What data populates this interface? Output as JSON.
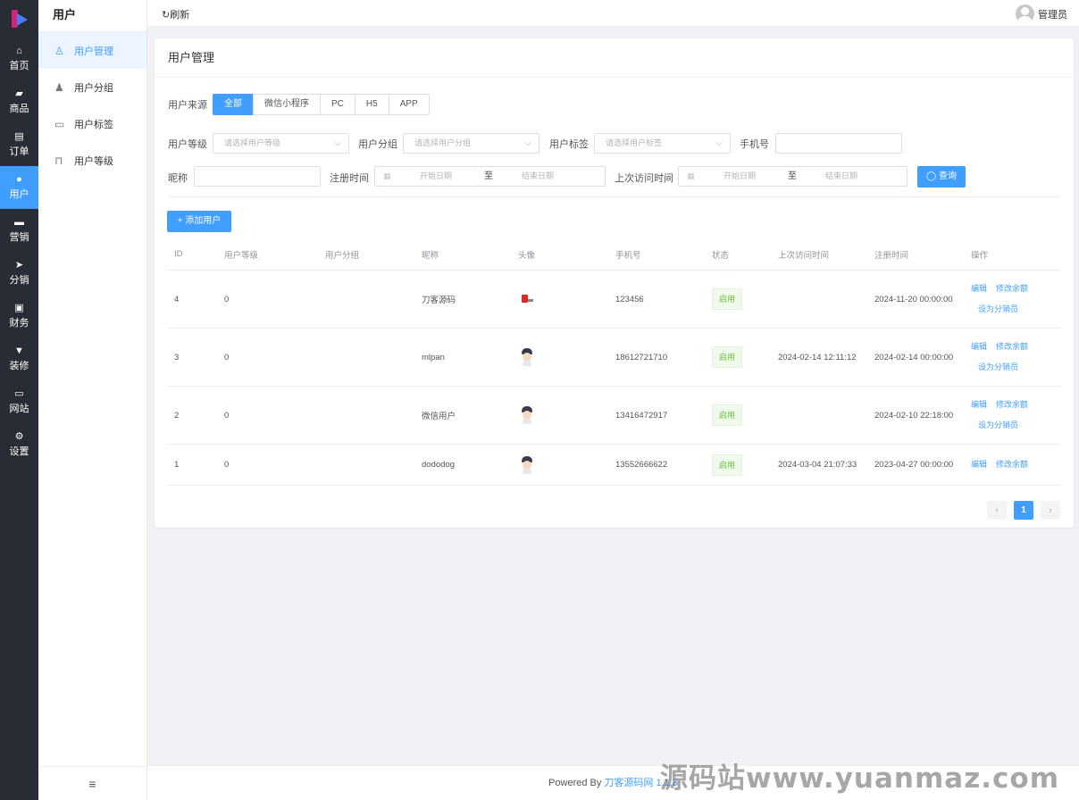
{
  "rail": {
    "items": [
      {
        "label": "首页",
        "icon": "home-icon",
        "glyph": "⌂"
      },
      {
        "label": "商品",
        "icon": "bag-icon",
        "glyph": "▰"
      },
      {
        "label": "订单",
        "icon": "order-icon",
        "glyph": "▤"
      },
      {
        "label": "用户",
        "icon": "user-icon",
        "glyph": "●"
      },
      {
        "label": "营销",
        "icon": "ticket-icon",
        "glyph": "▬"
      },
      {
        "label": "分销",
        "icon": "send-icon",
        "glyph": "➤"
      },
      {
        "label": "财务",
        "icon": "finance-icon",
        "glyph": "▣"
      },
      {
        "label": "装修",
        "icon": "brush-icon",
        "glyph": "▼"
      },
      {
        "label": "网站",
        "icon": "monitor-icon",
        "glyph": "▭"
      },
      {
        "label": "设置",
        "icon": "gear-icon",
        "glyph": "⚙"
      }
    ]
  },
  "submenu": {
    "title": "用户",
    "items": [
      {
        "label": "用户管理",
        "icon": "person-outline-icon",
        "glyph": "♙"
      },
      {
        "label": "用户分组",
        "icon": "user-group-icon",
        "glyph": "♟"
      },
      {
        "label": "用户标签",
        "icon": "tag-card-icon",
        "glyph": "▭"
      },
      {
        "label": "用户等级",
        "icon": "level-badge-icon",
        "glyph": "⊓"
      }
    ],
    "collapse_glyph": "≡"
  },
  "topbar": {
    "refresh": "↻刷新",
    "user": "管理员"
  },
  "page": {
    "title": "用户管理",
    "filters": {
      "source_label": "用户来源",
      "source_options": [
        "全部",
        "微信小程序",
        "PC",
        "H5",
        "APP"
      ],
      "level_label": "用户等级",
      "level_placeholder": "请选择用户等级",
      "group_label": "用户分组",
      "group_placeholder": "请选择用户分组",
      "tag_label": "用户标签",
      "tag_placeholder": "请选择用户标签",
      "phone_label": "手机号",
      "nickname_label": "昵称",
      "reg_time_label": "注册时间",
      "last_visit_label": "上次访问时间",
      "start_placeholder": "开始日期",
      "end_placeholder": "结束日期",
      "range_sep": "至",
      "search_button": "◯ 查询"
    },
    "add_button": "+ 添加用户"
  },
  "table": {
    "headers": [
      "ID",
      "用户等级",
      "用户分组",
      "昵称",
      "头像",
      "手机号",
      "状态",
      "上次访问时间",
      "注册时间",
      "操作"
    ],
    "rows": [
      {
        "id": "4",
        "level": "0",
        "group": "",
        "nickname": "刀客源码",
        "phone": "123456",
        "status": "启用",
        "last_visit": "",
        "registered": "2024-11-20 00:00:00",
        "ops": [
          "编辑",
          "修改余额"
        ],
        "ops2": "设为分销员"
      },
      {
        "id": "3",
        "level": "0",
        "group": "",
        "nickname": "mlpan",
        "phone": "18612721710",
        "status": "启用",
        "last_visit": "2024-02-14 12:11:12",
        "registered": "2024-02-14 00:00:00",
        "ops": [
          "编辑",
          "修改余额"
        ],
        "ops2": "设为分销员"
      },
      {
        "id": "2",
        "level": "0",
        "group": "",
        "nickname": "微信用户",
        "phone": "13416472917",
        "status": "启用",
        "last_visit": "",
        "registered": "2024-02-10 22:18:00",
        "ops": [
          "编辑",
          "修改余额"
        ],
        "ops2": "设为分销员"
      },
      {
        "id": "1",
        "level": "0",
        "group": "",
        "nickname": "dododog",
        "phone": "13552666622",
        "status": "启用",
        "last_visit": "2024-03-04 21:07:33",
        "registered": "2023-04-27 00:00:00",
        "ops": [
          "编辑",
          "修改余额"
        ],
        "ops2": ""
      }
    ]
  },
  "pagination": {
    "prev": "‹",
    "current": "1",
    "next": "›"
  },
  "footer": {
    "prefix": "Powered By ",
    "link": "刀客源码网 1.1.6"
  },
  "watermark": "源码站www.yuanmaz.com",
  "colors": {
    "primary": "#409eff",
    "rail": "#282c34",
    "success": "#67c23a"
  }
}
